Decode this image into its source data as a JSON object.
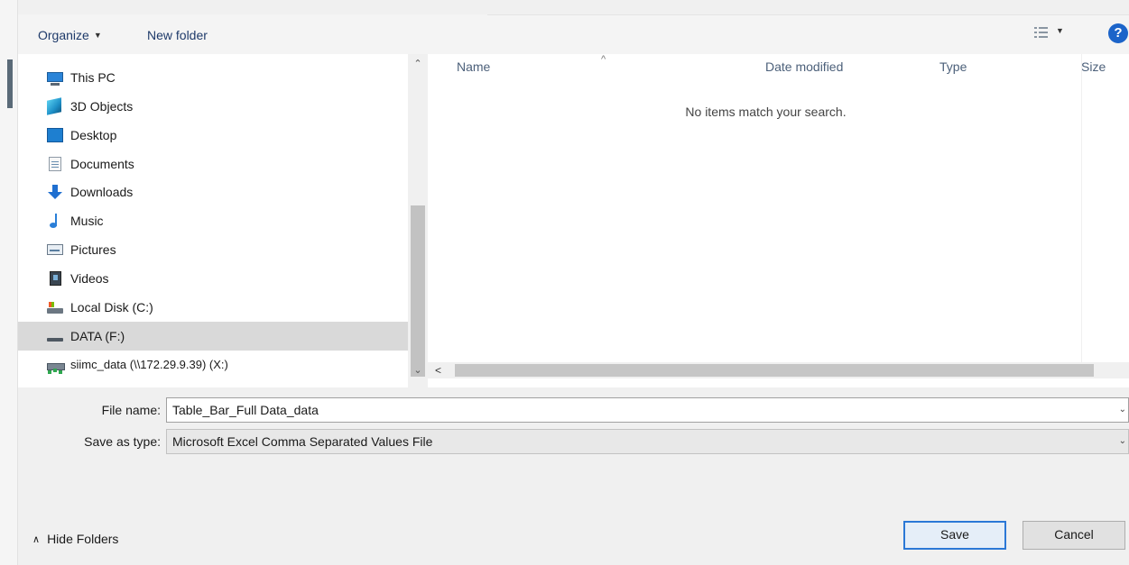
{
  "toolbar": {
    "organize_label": "Organize",
    "new_folder_label": "New folder",
    "help_symbol": "?"
  },
  "nav": {
    "items": [
      {
        "label": "This PC",
        "icon": "computer-icon"
      },
      {
        "label": "3D Objects",
        "icon": "3d-objects-icon"
      },
      {
        "label": "Desktop",
        "icon": "desktop-icon"
      },
      {
        "label": "Documents",
        "icon": "documents-icon"
      },
      {
        "label": "Downloads",
        "icon": "downloads-icon"
      },
      {
        "label": "Music",
        "icon": "music-icon"
      },
      {
        "label": "Pictures",
        "icon": "pictures-icon"
      },
      {
        "label": "Videos",
        "icon": "videos-icon"
      },
      {
        "label": "Local Disk (C:)",
        "icon": "disk-icon"
      },
      {
        "label": "DATA (F:)",
        "icon": "drive-icon",
        "selected": true
      },
      {
        "label": "siimc_data (\\\\172.29.9.39) (X:)",
        "icon": "network-drive-icon"
      }
    ]
  },
  "list": {
    "columns": {
      "name": "Name",
      "date_modified": "Date modified",
      "type": "Type",
      "size": "Size"
    },
    "empty_message": "No items match your search."
  },
  "form": {
    "file_name_label": "File name:",
    "file_name_value": "Table_Bar_Full Data_data",
    "save_type_label": "Save as type:",
    "save_type_value": "Microsoft Excel Comma Separated Values File"
  },
  "footer": {
    "hide_folders_label": "Hide Folders",
    "save_label": "Save",
    "cancel_label": "Cancel"
  },
  "colors": {
    "accent": "#2b78d6",
    "selection": "#d9d9d9",
    "link_text": "#1e3a6a"
  }
}
